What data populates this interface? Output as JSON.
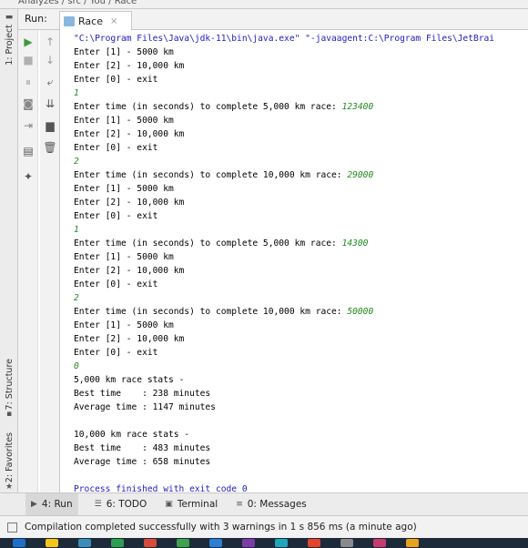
{
  "breadcrumb": [
    "Analyzes",
    "src",
    "You",
    "Race"
  ],
  "left_tabs": [
    {
      "label": "1: Project",
      "icon": "project-icon"
    },
    {
      "label": "7: Structure",
      "icon": "structure-icon"
    },
    {
      "label": "2: Favorites",
      "icon": "star-icon"
    }
  ],
  "run_panel": {
    "label": "Run:",
    "tab_label": "Race",
    "tab_close": "×"
  },
  "toolbar_left": [
    {
      "name": "rerun-icon",
      "glyph": "▶",
      "color": "#3c9a3c"
    },
    {
      "name": "stop-icon",
      "glyph": "■",
      "color": "#b0b0b0"
    },
    {
      "name": "pause-icon",
      "glyph": "⏸",
      "color": "#b0b0b0"
    },
    {
      "name": "camera-icon",
      "glyph": "◙",
      "color": "#888888"
    },
    {
      "name": "restore-layout-icon",
      "glyph": "⇥",
      "color": "#888888"
    },
    {
      "name": "layout-icon",
      "glyph": "▤",
      "color": "#555555"
    },
    {
      "name": "pin-icon",
      "glyph": "✦",
      "color": "#555555"
    }
  ],
  "toolbar_right": [
    {
      "name": "up-arrow-icon",
      "glyph": "↑",
      "color": "#9a9a9a"
    },
    {
      "name": "down-arrow-icon",
      "glyph": "↓",
      "color": "#9a9a9a"
    },
    {
      "name": "soft-wrap-icon",
      "glyph": "⤶",
      "color": "#555555"
    },
    {
      "name": "scroll-to-end-icon",
      "glyph": "⇊",
      "color": "#555555"
    },
    {
      "name": "print-icon",
      "glyph": "▆",
      "color": "#555555"
    },
    {
      "name": "trash-icon",
      "glyph": "🗑",
      "color": "#555555"
    }
  ],
  "console": {
    "lines": [
      {
        "type": "cmd",
        "text": "\"C:\\Program Files\\Java\\jdk-11\\bin\\java.exe\" \"-javaagent:C:\\Program Files\\JetBrai"
      },
      {
        "type": "out",
        "text": "Enter [1] - 5000 km"
      },
      {
        "type": "out",
        "text": "Enter [2] - 10,000 km"
      },
      {
        "type": "out",
        "text": "Enter [0] - exit"
      },
      {
        "type": "in",
        "text": "1"
      },
      {
        "type": "prompt",
        "text": "Enter time (in seconds) to complete 5,000 km race: ",
        "input": "123400"
      },
      {
        "type": "out",
        "text": "Enter [1] - 5000 km"
      },
      {
        "type": "out",
        "text": "Enter [2] - 10,000 km"
      },
      {
        "type": "out",
        "text": "Enter [0] - exit"
      },
      {
        "type": "in",
        "text": "2"
      },
      {
        "type": "prompt",
        "text": "Enter time (in seconds) to complete 10,000 km race: ",
        "input": "29000"
      },
      {
        "type": "out",
        "text": "Enter [1] - 5000 km"
      },
      {
        "type": "out",
        "text": "Enter [2] - 10,000 km"
      },
      {
        "type": "out",
        "text": "Enter [0] - exit"
      },
      {
        "type": "in",
        "text": "1"
      },
      {
        "type": "prompt",
        "text": "Enter time (in seconds) to complete 5,000 km race: ",
        "input": "14300"
      },
      {
        "type": "out",
        "text": "Enter [1] - 5000 km"
      },
      {
        "type": "out",
        "text": "Enter [2] - 10,000 km"
      },
      {
        "type": "out",
        "text": "Enter [0] - exit"
      },
      {
        "type": "in",
        "text": "2"
      },
      {
        "type": "prompt",
        "text": "Enter time (in seconds) to complete 10,000 km race: ",
        "input": "50000"
      },
      {
        "type": "out",
        "text": "Enter [1] - 5000 km"
      },
      {
        "type": "out",
        "text": "Enter [2] - 10,000 km"
      },
      {
        "type": "out",
        "text": "Enter [0] - exit"
      },
      {
        "type": "in",
        "text": "0"
      },
      {
        "type": "out",
        "text": "5,000 km race stats -"
      },
      {
        "type": "out",
        "text": "Best time    : 238 minutes"
      },
      {
        "type": "out",
        "text": "Average time : 1147 minutes"
      },
      {
        "type": "out",
        "text": ""
      },
      {
        "type": "out",
        "text": "10,000 km race stats -"
      },
      {
        "type": "out",
        "text": "Best time    : 483 minutes"
      },
      {
        "type": "out",
        "text": "Average time : 658 minutes"
      },
      {
        "type": "out",
        "text": ""
      },
      {
        "type": "proc",
        "text": "Process finished with exit code 0"
      }
    ]
  },
  "bottom_tabs": [
    {
      "label": "4: Run",
      "icon": "run-icon",
      "glyph": "▶",
      "active": true
    },
    {
      "label": "6: TODO",
      "icon": "todo-icon",
      "glyph": "☰",
      "active": false
    },
    {
      "label": "Terminal",
      "icon": "terminal-icon",
      "glyph": "▣",
      "active": false
    },
    {
      "label": "0: Messages",
      "icon": "messages-icon",
      "glyph": "≡",
      "active": false
    }
  ],
  "status": {
    "message": "Compilation completed successfully with 3 warnings in 1 s 856 ms (a minute ago)"
  },
  "taskbar": {
    "app_colors": [
      "#1e6fc8",
      "#f5c518",
      "#3b8dbd",
      "#2e9e4f",
      "#d84a3a",
      "#3fa34d",
      "#2b7fd4",
      "#7e3ba8",
      "#1ea7b9",
      "#e4442e",
      "#8a8a8a",
      "#c83b6e",
      "#e8a21c"
    ]
  }
}
